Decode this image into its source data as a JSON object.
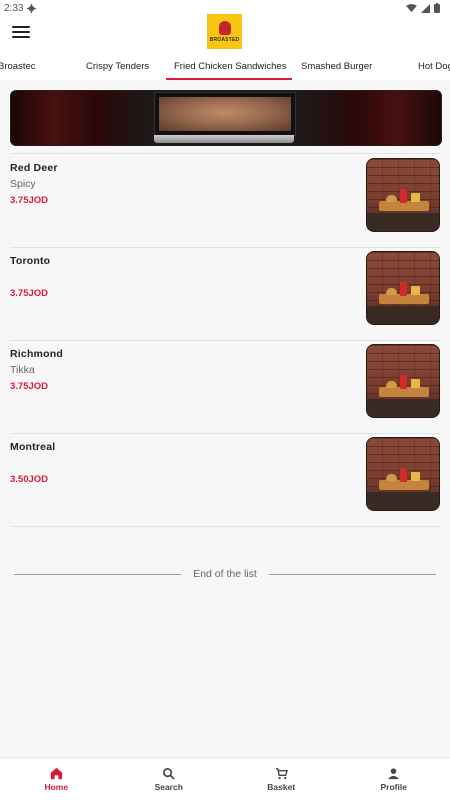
{
  "status_bar": {
    "time": "2:33"
  },
  "app": {
    "logo_text": "BROASTED"
  },
  "tabs": [
    {
      "label": "Broastec"
    },
    {
      "label": "Crispy Tenders"
    },
    {
      "label": "Fried Chicken Sandwiches",
      "active": true
    },
    {
      "label": "Smashed Burger"
    },
    {
      "label": "Hot Dog"
    }
  ],
  "items": [
    {
      "name": "Red Deer",
      "description": "Spicy",
      "price": "3.75JOD"
    },
    {
      "name": "Toronto",
      "description": "",
      "price": "3.75JOD"
    },
    {
      "name": "Richmond",
      "description": "Tikka",
      "price": "3.75JOD"
    },
    {
      "name": "Montreal",
      "description": "",
      "price": "3.50JOD"
    }
  ],
  "end_of_list": "End of the list",
  "bottom_nav": [
    {
      "label": "Home",
      "icon": "home-icon",
      "active": true
    },
    {
      "label": "Search",
      "icon": "search-icon"
    },
    {
      "label": "Basket",
      "icon": "cart-icon"
    },
    {
      "label": "Profile",
      "icon": "person-icon"
    }
  ],
  "colors": {
    "accent": "#d61b3c",
    "logo_bg": "#f9c712"
  }
}
